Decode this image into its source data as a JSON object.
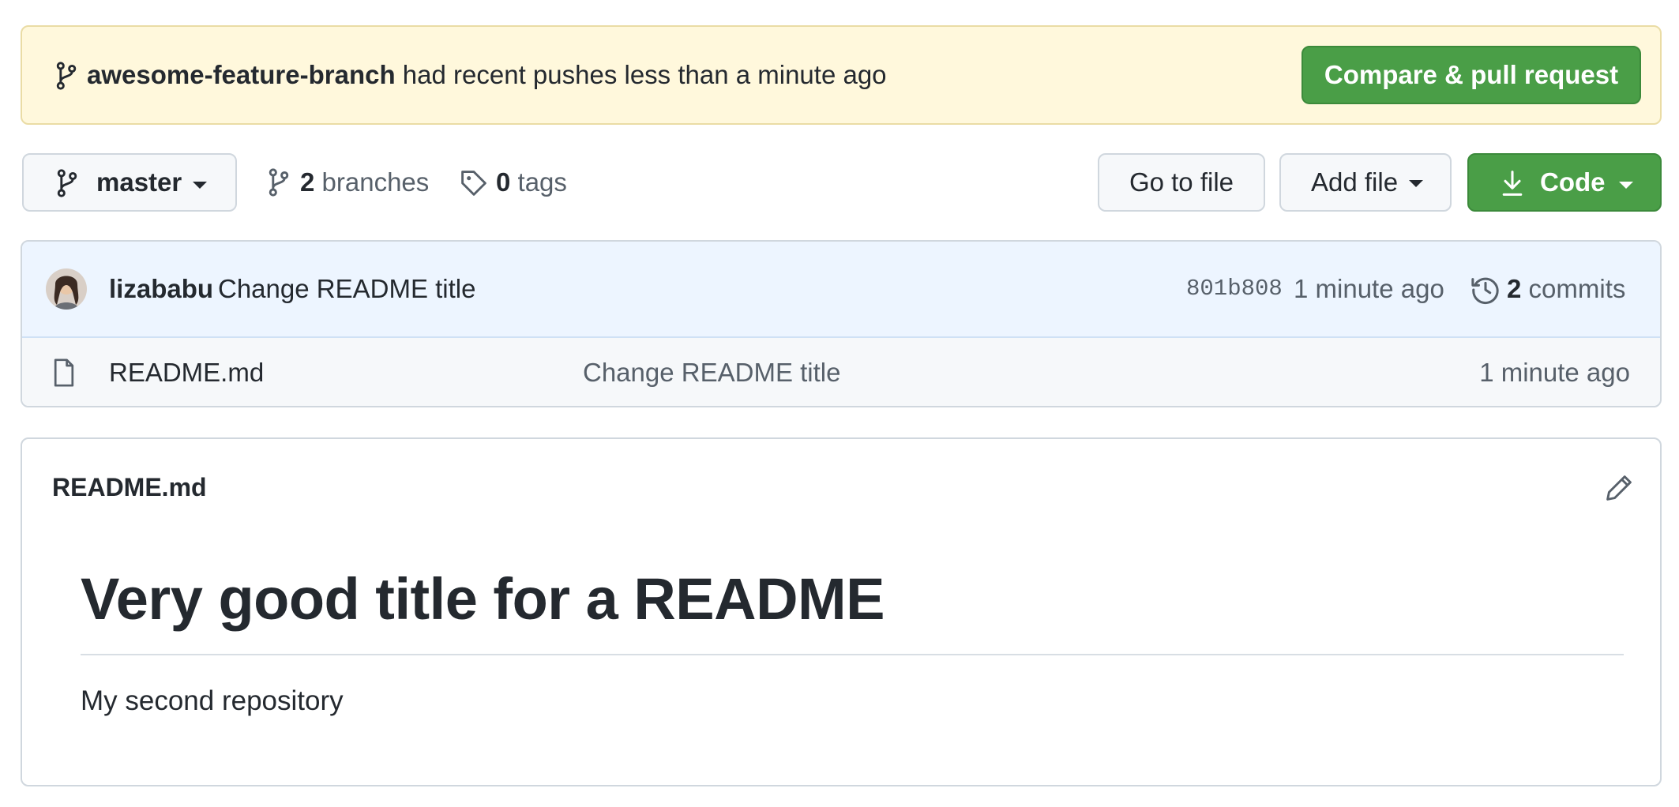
{
  "banner": {
    "branch_name": "awesome-feature-branch",
    "message": " had recent pushes less than a minute ago",
    "compare_button": "Compare & pull request"
  },
  "toolbar": {
    "branch_selector": "master",
    "branches_count": "2",
    "branches_label": " branches",
    "tags_count": "0",
    "tags_label": " tags",
    "go_to_file": "Go to file",
    "add_file": "Add file",
    "code": "Code"
  },
  "latest_commit": {
    "author": "lizababu",
    "message": "Change README title",
    "sha": "801b808",
    "time": "1 minute ago",
    "commits_count": "2",
    "commits_label": " commits"
  },
  "files": [
    {
      "name": "README.md",
      "commit_message": "Change README title",
      "time": "1 minute ago",
      "icon": "file-icon"
    }
  ],
  "readme": {
    "filename": "README.md",
    "heading": "Very good title for a README",
    "paragraph": "My second repository"
  },
  "colors": {
    "banner_bg": "#fff8dc",
    "primary_green": "#4a9e47",
    "commit_row_bg": "#edf5ff"
  }
}
